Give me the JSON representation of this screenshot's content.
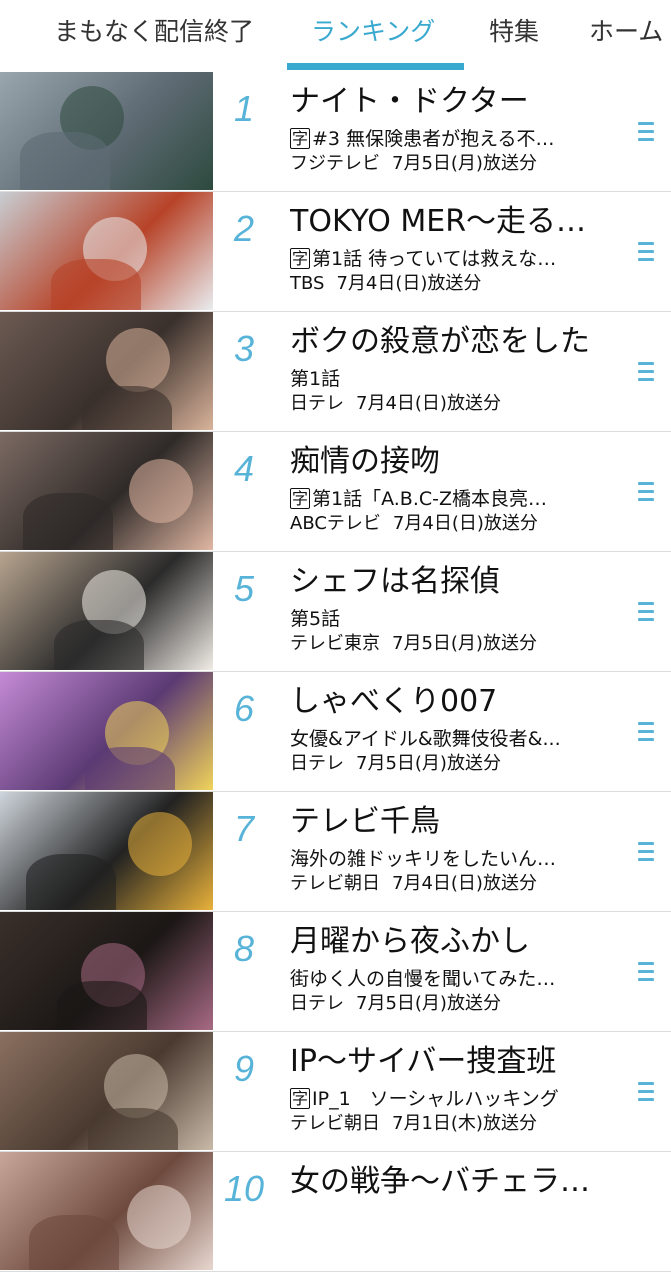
{
  "tabs": [
    {
      "label": "まもなく配信終了",
      "active": false
    },
    {
      "label": "ランキング",
      "active": true
    },
    {
      "label": "特集",
      "active": false
    },
    {
      "label": "ホーム",
      "active": false
    }
  ],
  "colors": {
    "accent": "#3aa9cf",
    "rank": "#58b3d8",
    "divider": "#dcdcdc"
  },
  "ranking": [
    {
      "rank": "1",
      "title": "ナイト・ドクター",
      "cc": true,
      "cc_label": "字",
      "subtitle": "#3 無保険患者が抱える不…",
      "channel": "フジテレビ",
      "date": "7月5日(月)放送分"
    },
    {
      "rank": "2",
      "title": "TOKYO MER～走る…",
      "cc": true,
      "cc_label": "字",
      "subtitle": "第1話 待っていては救えな…",
      "channel": "TBS",
      "date": "7月4日(日)放送分"
    },
    {
      "rank": "3",
      "title": "ボクの殺意が恋をした",
      "cc": false,
      "subtitle": "第1話",
      "channel": "日テレ",
      "date": "7月4日(日)放送分"
    },
    {
      "rank": "4",
      "title": "痴情の接吻",
      "cc": true,
      "cc_label": "字",
      "subtitle": "第1話「A.B.C-Z橋本良亮…",
      "channel": "ABCテレビ",
      "date": "7月4日(日)放送分"
    },
    {
      "rank": "5",
      "title": "シェフは名探偵",
      "cc": false,
      "subtitle": "第5話",
      "channel": "テレビ東京",
      "date": "7月5日(月)放送分"
    },
    {
      "rank": "6",
      "title": "しゃべくり007",
      "cc": false,
      "subtitle": "女優&アイドル&歌舞伎役者&...",
      "channel": "日テレ",
      "date": "7月5日(月)放送分"
    },
    {
      "rank": "7",
      "title": "テレビ千鳥",
      "cc": false,
      "subtitle": "海外の雑ドッキリをしたいん…",
      "channel": "テレビ朝日",
      "date": "7月4日(日)放送分"
    },
    {
      "rank": "8",
      "title": "月曜から夜ふかし",
      "cc": false,
      "subtitle": "街ゆく人の自慢を聞いてみた…",
      "channel": "日テレ",
      "date": "7月5日(月)放送分"
    },
    {
      "rank": "9",
      "title": "IP～サイバー捜査班",
      "cc": true,
      "cc_label": "字",
      "subtitle": "IP_1　ソーシャルハッキング",
      "channel": "テレビ朝日",
      "date": "7月1日(木)放送分"
    },
    {
      "rank": "10",
      "title": "女の戦争～バチェラ…",
      "cc": false,
      "subtitle": "",
      "channel": "",
      "date": ""
    }
  ]
}
